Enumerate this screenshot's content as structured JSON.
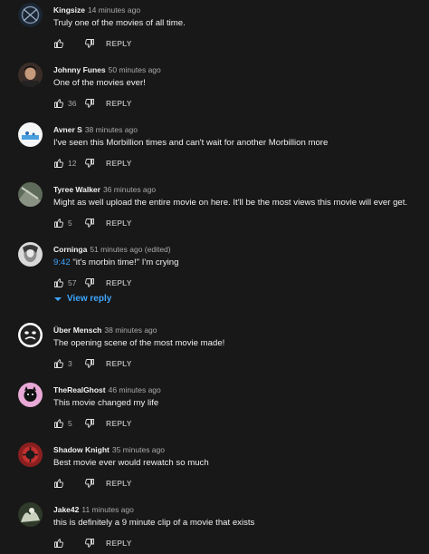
{
  "comments": [
    {
      "author": "Kingsize",
      "time": "14 minutes ago",
      "text": "Truly one of the movies of all time.",
      "likes": "",
      "reply": "REPLY"
    },
    {
      "author": "Johnny Funes",
      "time": "50 minutes ago",
      "text": "One of the movies ever!",
      "likes": "36",
      "reply": "REPLY"
    },
    {
      "author": "Avner S",
      "time": "38 minutes ago",
      "text": "I've seen this Morbillion times and can't wait for another Morbillion more",
      "likes": "12",
      "reply": "REPLY"
    },
    {
      "author": "Tyree Walker",
      "time": "36 minutes ago",
      "text": "Might as well upload the entire movie on here. It'll be the most views this movie will ever get.",
      "likes": "5",
      "reply": "REPLY"
    },
    {
      "author": "Corninga",
      "time": "51 minutes ago (edited)",
      "timestamp": "9:42",
      "text": " \"it's morbin time!\" I'm crying",
      "likes": "57",
      "reply": "REPLY"
    },
    {
      "author": "Über Mensch",
      "time": "38 minutes ago",
      "text": "The opening scene of the most movie made!",
      "likes": "3",
      "reply": "REPLY"
    },
    {
      "author": "TheRealGhost",
      "time": "46 minutes ago",
      "text": "This movie changed my life",
      "likes": "5",
      "reply": "REPLY"
    },
    {
      "author": "Shadow Knight",
      "time": "35 minutes ago",
      "text": "Best movie ever would rewatch so much",
      "likes": "",
      "reply": "REPLY"
    },
    {
      "author": "Jake42",
      "time": "11 minutes ago",
      "text": "this is definitely a 9 minute clip of a movie that exists",
      "likes": "",
      "reply": "REPLY"
    }
  ],
  "view_reply": "View reply",
  "icons": {
    "like": "thumbs-up-icon",
    "dislike": "thumbs-down-icon",
    "expand": "chevron-down-icon"
  },
  "colors": {
    "background": "#181818",
    "text": "#f1f1f1",
    "secondary": "#aaaaaa",
    "link": "#3ea6ff"
  }
}
